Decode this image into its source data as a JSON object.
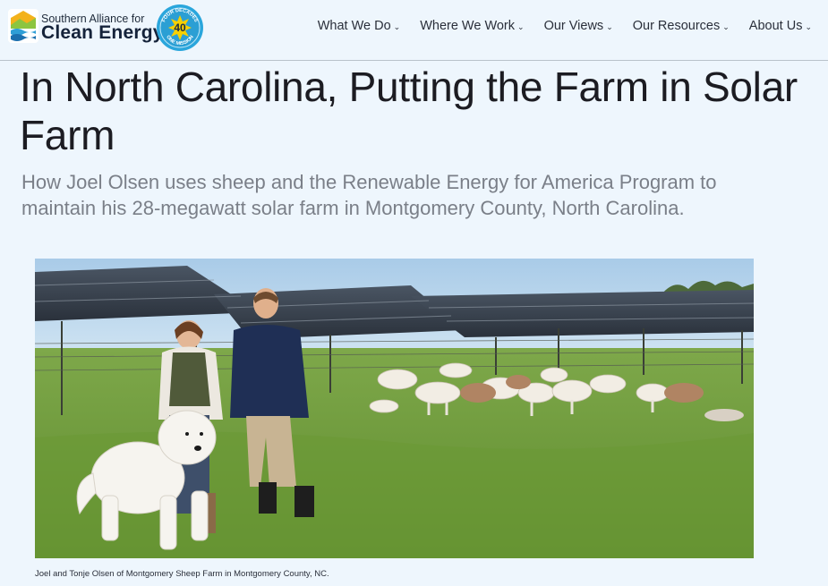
{
  "header": {
    "brand_line1": "Southern Alliance for",
    "brand_line2": "Clean Energy",
    "badge": {
      "number": "40",
      "arc_top": "FOUR DECADES",
      "arc_bottom": "ONE MISSION"
    },
    "nav": [
      {
        "label": "What We Do",
        "icon": "chevron-down-icon"
      },
      {
        "label": "Where We Work",
        "icon": "chevron-down-icon"
      },
      {
        "label": "Our Views",
        "icon": "chevron-down-icon"
      },
      {
        "label": "Our Resources",
        "icon": "chevron-down-icon"
      },
      {
        "label": "About Us",
        "icon": "chevron-down-icon"
      }
    ]
  },
  "article": {
    "title": "In North Carolina, Putting the Farm in Solar Farm",
    "subtitle": "How Joel Olsen uses sheep and the Renewable Energy for America Program to maintain his 28-megawatt solar farm in Montgomery County, North Carolina.",
    "caption": "Joel and Tonje Olsen of Montgomery Sheep Farm in Montgomery County, NC."
  },
  "colors": {
    "page_bg": "#eef6fd",
    "brand_navy": "#15233a",
    "subtitle_gray": "#7a7f88",
    "grass": "#6f9a3c",
    "sky": "#b9d6ee"
  }
}
